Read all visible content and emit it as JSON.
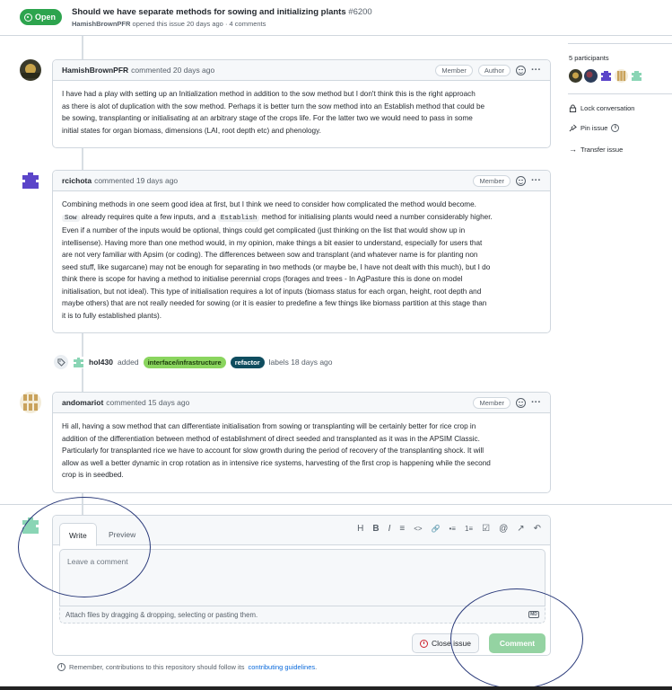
{
  "header": {
    "status": "Open",
    "title": "Should we have separate methods for sowing and initializing plants",
    "number": "#6200",
    "opener": "HamishBrownPFR",
    "meta": "opened this issue 20 days ago · 4 comments"
  },
  "comments": [
    {
      "author": "HamishBrownPFR",
      "when": "commented 20 days ago",
      "badges": [
        "Member",
        "Author"
      ],
      "lines": [
        "I have had a play with setting up an Initialization method in addition to the sow method but I don't think this is the right approach",
        "as there is alot of duplication with the sow method. Perhaps it is better turn the sow method into an Establish method that could be",
        "be sowing, transplanting or initialisating at an arbitrary stage of the crops life. For the latter two we would need to pass in some",
        "initial states for organ biomass, dimensions (LAI, root depth etc) and phenology."
      ]
    },
    {
      "author": "rcichota",
      "when": "commented 19 days ago",
      "badges": [
        "Member"
      ],
      "line1": "Combining methods in one seem good idea at first, but I think we need to consider how complicated the method would become.",
      "code1": "Sow",
      "line2a": " already requires quite a few inputs, and a ",
      "code2": "Establish",
      "line2b": " method for initialising plants would need a number considerably higher.",
      "lines": [
        "Even if a number of the inputs would be optional, things could get complicated (just thinking on the list that would show up in",
        "intellisense). Having more than one method would, in my opinion, make things a bit easier to understand, especially for users that",
        "are not very familiar with Apsim (or coding). The differences between sow and transplant (and whatever name is for planting non",
        "seed stuff, like sugarcane) may not be enough for separating in two methods (or maybe be, I have not dealt with this much), but I do",
        "think there is scope for having a method to initialise perennial crops (forages and trees - In AgPasture this is done on model",
        "initialisation, but not ideal). This type of initialisation requires a lot of inputs (biomass status for each organ, height, root depth and",
        "maybe others) that are not really needed for sowing (or it is easier to predefine a few things like biomass partition at this stage than",
        "it is to fully established plants)."
      ]
    },
    {
      "author": "andomariot",
      "when": "commented 15 days ago",
      "badges": [
        "Member"
      ],
      "lines": [
        "Hi all, having a sow method that can differentiate initialisation from sowing or transplanting will be certainly better for rice crop in",
        "addition of the differentiation between method of establishment of direct seeded and transplanted as it was in the APSIM Classic.",
        "Particularly for transplanted rice we have to account for slow growth during the period of recovery of the transplanting shock. It will",
        "allow as well a better dynamic in crop rotation as in intensive rice systems, harvesting of the first crop is happening while the second",
        "crop is in seedbed."
      ]
    }
  ],
  "label_event": {
    "actor": "hol430",
    "verb": "added",
    "labels": [
      "interface/infrastructure",
      "refactor"
    ],
    "suffix": "labels 18 days ago",
    "label_colors": [
      "#8ad55e",
      "#0f4d5f"
    ]
  },
  "sidebar": {
    "participants": "5 participants",
    "lock": "Lock conversation",
    "pin": "Pin issue",
    "transfer": "Transfer issue"
  },
  "editor": {
    "tab_write": "Write",
    "tab_preview": "Preview",
    "tools": [
      "H",
      "B",
      "I",
      "≡",
      "<>",
      "🔗",
      "•≡",
      "1≡",
      "☑",
      "@",
      "↗",
      "↶"
    ],
    "placeholder": "Leave a comment",
    "attach": "Attach files by dragging & dropping, selecting or pasting them.",
    "md": "MD",
    "close_label": "Close issue",
    "comment_label": "Comment"
  },
  "footer": {
    "note": "Remember, contributions to this repository should follow its",
    "link": "contributing guidelines",
    "end": "."
  },
  "colors": {
    "open_green": "#2da44e",
    "comment_btn": "#94d3a2",
    "link_blue": "#0969da",
    "annotation_ring": "#2a3a7a"
  }
}
